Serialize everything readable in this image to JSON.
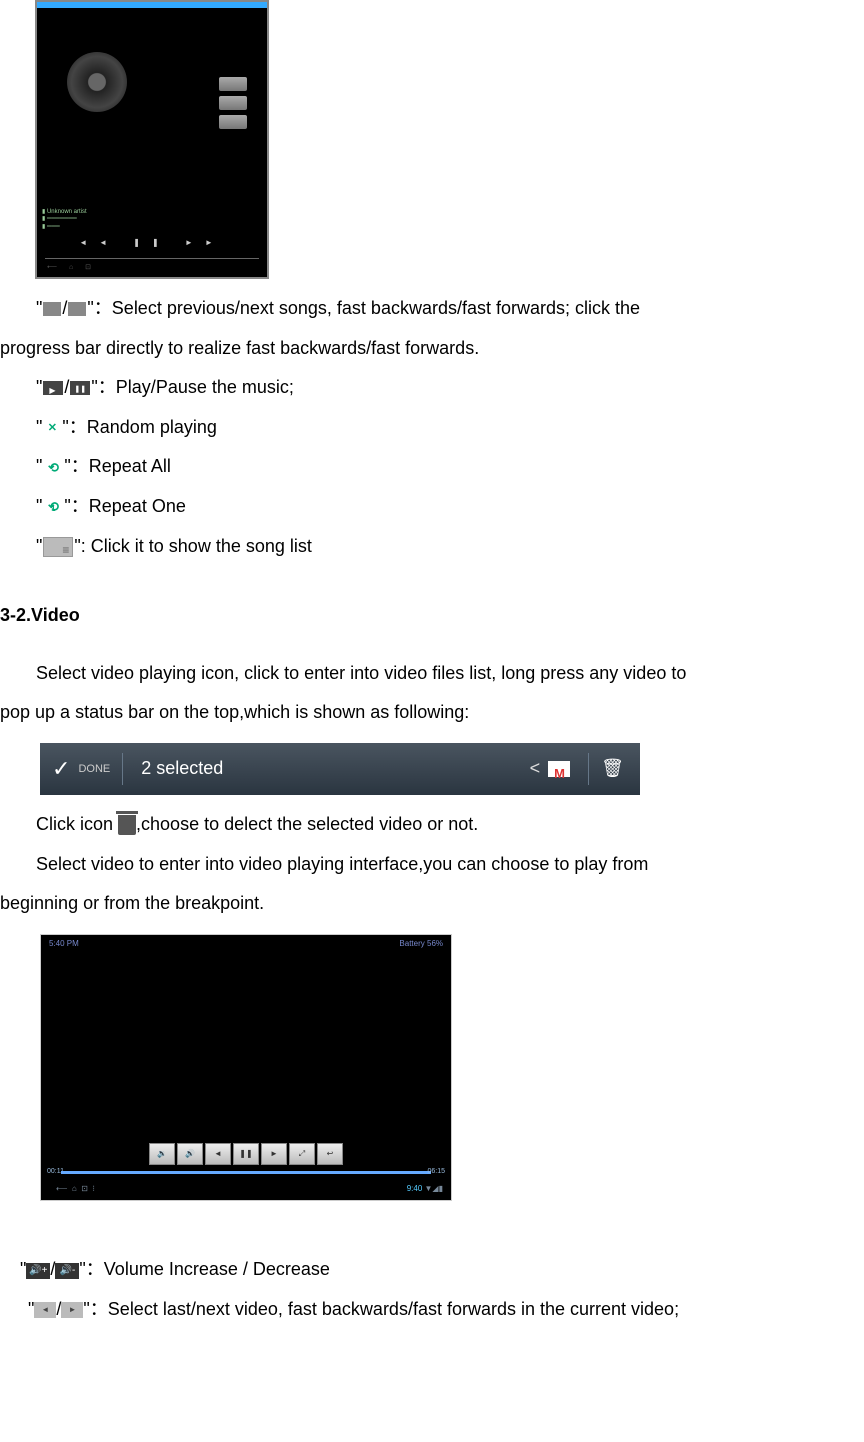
{
  "music_player": {
    "track_label": "Unknown artist",
    "controls": "◄◄   ❚❚   ►►",
    "nav": "⟵  ⌂  ⊡"
  },
  "music_section": {
    "prev_next_text": "：Select previous/next songs, fast backwards/fast forwards; click the",
    "prev_next_cont": "progress bar directly to realize fast backwards/fast forwards.",
    "play_pause": "：Play/Pause the music;",
    "random": "：Random playing",
    "repeat_all": "：Repeat All",
    "repeat_one": "：Repeat One",
    "song_list": ": Click it to show the song list"
  },
  "video_heading": "3-2.Video",
  "video_intro_1": "Select video playing icon, click to enter into video files list, long press any video to",
  "video_intro_2": "pop up a status bar on the top,which is shown as following:",
  "selection_bar": {
    "done": "DONE",
    "count": "2 selected"
  },
  "trash_text_1": "Click icon ",
  "trash_text_2": ",choose to delect the selected video or not.",
  "video_play_1": "Select video to enter into video playing interface,you can choose to play from",
  "video_play_2": "beginning or from the breakpoint.",
  "video_player": {
    "time_tl": "5:40 PM",
    "battery": "Battery 56%",
    "time_l": "00:11",
    "time_r": "06:15",
    "clock": "9:40",
    "signal": "▼◢▮"
  },
  "volume_text": "：Volume Increase / Decrease",
  "vid_nav_text": "：Select last/next video, fast backwards/fast forwards in the current video;"
}
